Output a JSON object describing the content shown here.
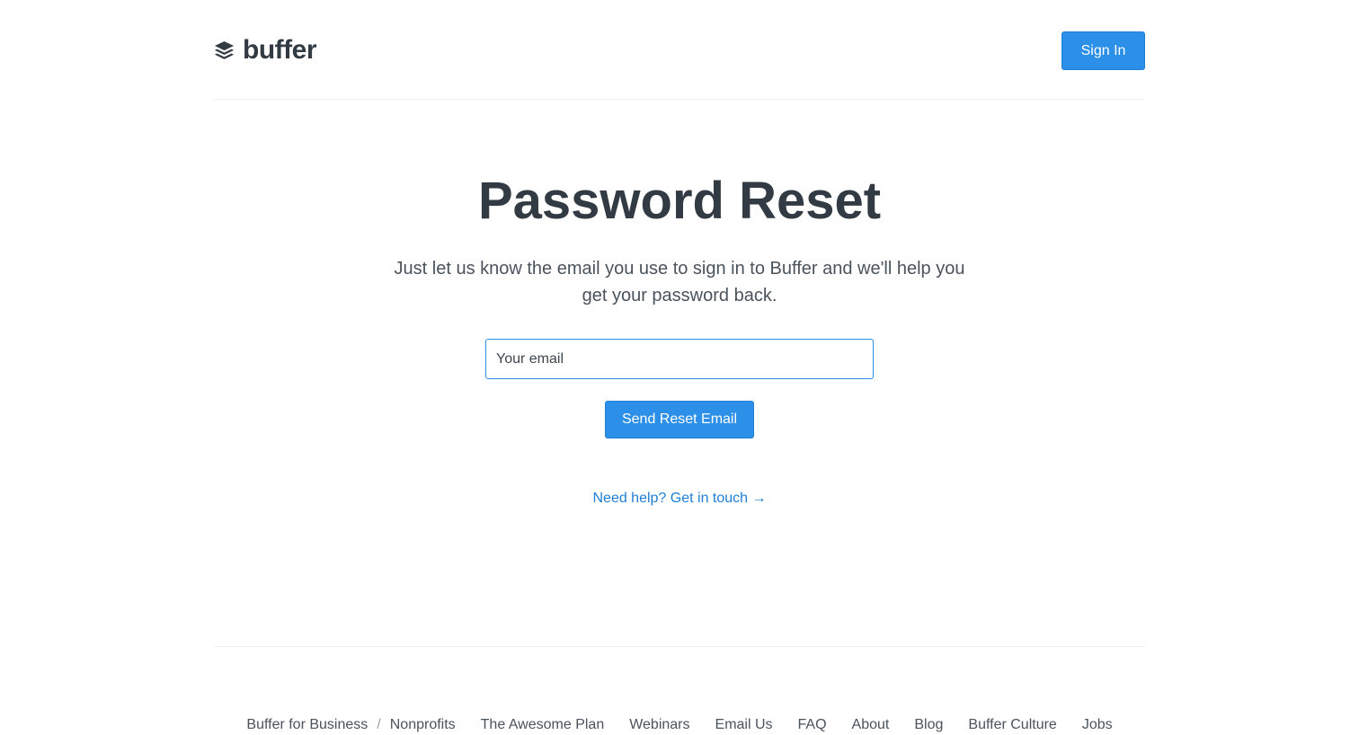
{
  "header": {
    "logo_text": "buffer",
    "logo_icon": "stacked-layers-icon",
    "signin_label": "Sign In"
  },
  "main": {
    "title": "Password Reset",
    "subtitle": "Just let us know the email you use to sign in to Buffer and we'll help you get your password back.",
    "email_placeholder": "Your email",
    "send_label": "Send Reset Email",
    "help_link": "Need help? Get in touch →"
  },
  "footer": {
    "business_label": "Buffer for Business",
    "separator": "/",
    "nonprofits_label": "Nonprofits",
    "links": [
      "The Awesome Plan",
      "Webinars",
      "Email Us",
      "FAQ",
      "About",
      "Blog",
      "Buffer Culture",
      "Jobs"
    ]
  },
  "colors": {
    "accent": "#2c8fe8",
    "text_dark": "#323b43",
    "link": "#1f7fd4"
  }
}
